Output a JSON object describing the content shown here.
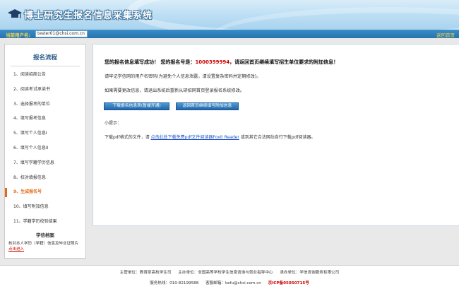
{
  "header": {
    "site_title": "博士研究生报名信息采集系统"
  },
  "userbar": {
    "label": "当前用户名:",
    "username": "tester01@chsi.com.cn",
    "home_link": "返回首页"
  },
  "sidebar": {
    "title": "报名流程",
    "steps": [
      {
        "label": "1、阅读招商公告"
      },
      {
        "label": "2、阅读考试承诺书"
      },
      {
        "label": "3、选择报考的单位"
      },
      {
        "label": "4、填写报考信息"
      },
      {
        "label": "5、填写个人信息I"
      },
      {
        "label": "6、填写个人信息II"
      },
      {
        "label": "7、填写学籍学历信息"
      },
      {
        "label": "8、校对填报信息"
      },
      {
        "label": "9、生成报名号"
      },
      {
        "label": "10、填写附加信息"
      },
      {
        "label": "11、学籍学历校验结果"
      }
    ],
    "active_step": 8
  },
  "archive": {
    "title": "学信档案",
    "text": "核对本人学历（学籍）信息及毕业证照片",
    "link": "点击进入"
  },
  "content": {
    "success_prefix": "您的报名信息填写成功！ 您的报名号是：",
    "registration_number": "1000399994",
    "success_suffix": "，请返回首页继续填写招生单位要求的附加信息！",
    "line2": "请牢记学信网的用户名密码(为避免个人信息泄露，请设置复杂密码并定期修改)。",
    "line3": "如果需要更改信息，请退出系统后重新从研招网首页登录报名系统修改。",
    "btn_download": "下载报名信息表(暂缓开通)",
    "btn_return": "返回首页继续填写附加信息",
    "tip": "小提示：",
    "dl_prefix": "下载pdf格式的文件，请 ",
    "dl_link": "点击此处下载免费pdf文件阅读器Foxit Reader",
    "dl_suffix": " 或到其它合法网站自行下载pdf阅读器。"
  },
  "footer": {
    "sponsor": "主管单位：教育部高校学生司",
    "organizer": "主办单位：全国高等学校学生信息咨询与就业指导中心",
    "operator": "承办单位：学信咨询服务有限公司",
    "hotline": "服务热线：010-82199588",
    "email": "客服邮箱：kefu@chsi.com.cn",
    "icp": "京ICP备05050715号"
  }
}
